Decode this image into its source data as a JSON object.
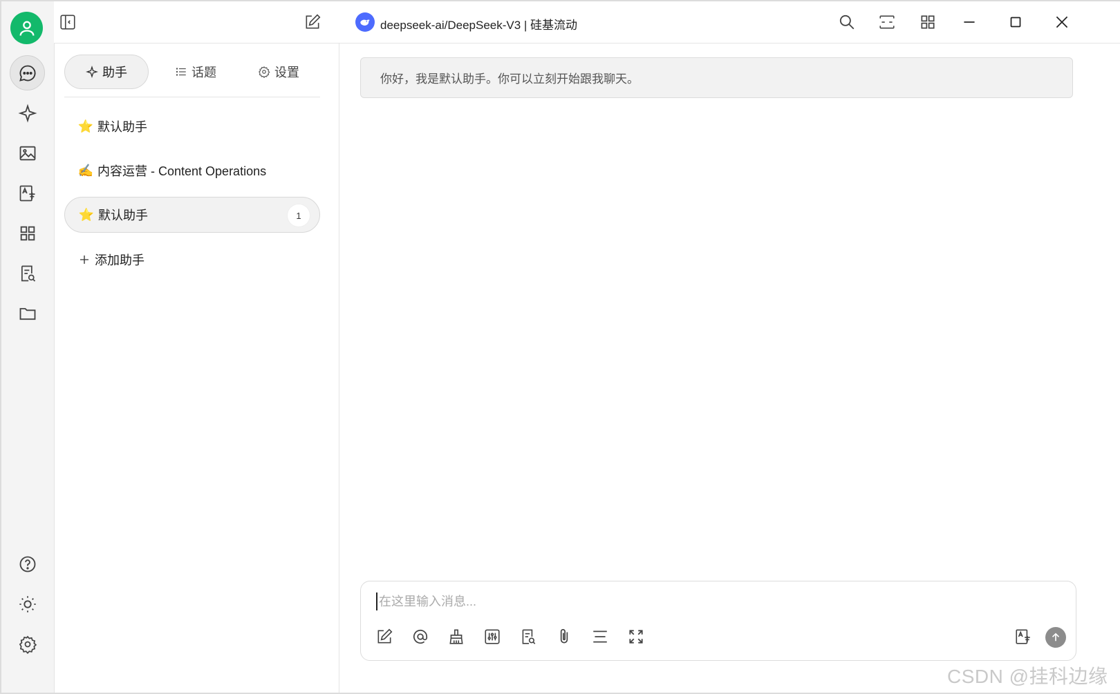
{
  "topbar": {
    "model_title": "deepseek-ai/DeepSeek-V3 | 硅基流动"
  },
  "tabs": [
    {
      "label": "助手",
      "icon": "sparkle-icon"
    },
    {
      "label": "话题",
      "icon": "list-icon"
    },
    {
      "label": "设置",
      "icon": "gear-icon"
    }
  ],
  "assistants": [
    {
      "emoji": "⭐",
      "label": "默认助手"
    },
    {
      "emoji": "✍️",
      "label": "内容运营 - Content Operations"
    },
    {
      "emoji": "⭐",
      "label": "默认助手",
      "count": "1"
    }
  ],
  "add_assistant": "添加助手",
  "chat": {
    "greeting": "你好，我是默认助手。你可以立刻开始跟我聊天。",
    "input_placeholder": "在这里输入消息..."
  },
  "watermark": "CSDN @挂科边缘",
  "colors": {
    "accent_green": "#13b96b",
    "deepseek_blue": "#4d6bfe"
  }
}
